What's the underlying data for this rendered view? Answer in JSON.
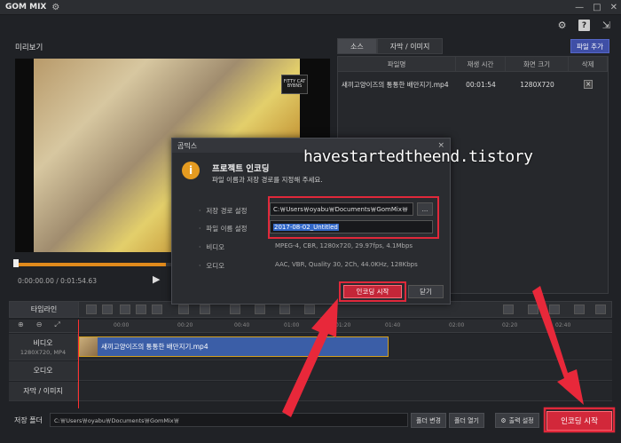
{
  "app": {
    "title": "GOM MIX",
    "gear_icon": "gear-icon"
  },
  "window": {
    "minimize": "—",
    "maximize": "□",
    "close": "✕"
  },
  "top_icons": {
    "settings": "⚙",
    "help": "?",
    "export": "⇲"
  },
  "preview": {
    "label": "미리보기",
    "timecode": "0:00:00.00 / 0:01:54.63",
    "video_watermark": "FITTY CAT BYBNS",
    "progress": 0.48
  },
  "file_panel": {
    "tabs": [
      {
        "label": "소스"
      },
      {
        "label": "자막 / 이미지"
      }
    ],
    "add_file": "파일 추가",
    "columns": [
      "파일명",
      "재생 시간",
      "화면 크기",
      "삭제"
    ],
    "rows": [
      {
        "name": "새끼고양이즈의 통통한 배만지기.mp4",
        "duration": "00:01:54",
        "size": "1280X720",
        "delete": "×"
      }
    ]
  },
  "timeline": {
    "label": "타임라인",
    "ticks": [
      "00:00",
      "00:20",
      "00:40",
      "01:00",
      "01:20",
      "01:40",
      "02:00",
      "02:20",
      "02:40"
    ],
    "tracks": [
      {
        "title": "비디오",
        "sub": "1280X720, MP4"
      },
      {
        "title": "오디오",
        "sub": ""
      },
      {
        "title": "자막 / 이미지",
        "sub": ""
      }
    ],
    "clip_name": "새끼고양이즈의 통통한 배만지기.mp4"
  },
  "bottom": {
    "save_label": "저장 폴더",
    "save_path": "C:￦Users￦oyabu￦Documents￦GomMix￦",
    "folder_change": "폴더 변경",
    "folder_open": "폴더 열기",
    "output_settings": "출력 설정",
    "encode_start": "인코딩 시작"
  },
  "dialog": {
    "title": "곰믹스",
    "close": "×",
    "heading": "프로젝트 인코딩",
    "subtitle": "파일 이름과 저장 경로를 지정해 주세요.",
    "save_path_label": "저장 경로 설정",
    "save_path_value": "C:￦Users￦oyabu￦Documents￦GomMix￦",
    "browse": "...",
    "filename_label": "파일 이름 설정",
    "filename_value": "2017-08-02_Untitled",
    "video_label": "비디오",
    "video_value": "MPEG-4, CBR, 1280x720, 29.97fps, 4.1Mbps",
    "audio_label": "오디오",
    "audio_value": "AAC, VBR, Quality 30, 2Ch, 44.0KHz, 128Kbps",
    "encode_button": "인코딩 시작",
    "close_button": "닫기"
  },
  "overlay": {
    "watermark": "havestartedtheend.tistory"
  }
}
